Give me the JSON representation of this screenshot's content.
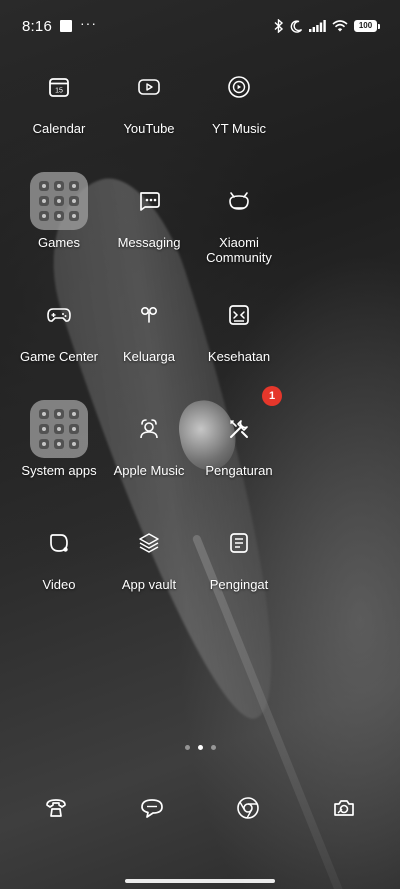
{
  "status_bar": {
    "time": "8:16",
    "more_indicator": "···",
    "battery_level": "100"
  },
  "apps": [
    {
      "label": "Calendar",
      "icon": "calendar-icon",
      "calendar_day": "15"
    },
    {
      "label": "YouTube",
      "icon": "youtube-icon"
    },
    {
      "label": "YT Music",
      "icon": "yt-music-icon"
    },
    {
      "label": "Games",
      "icon": "folder-icon"
    },
    {
      "label": "Messaging",
      "icon": "messaging-icon"
    },
    {
      "label": "Xiaomi Community",
      "icon": "xiaomi-community-icon"
    },
    {
      "label": "Game Center",
      "icon": "gamepad-icon"
    },
    {
      "label": "Keluarga",
      "icon": "family-link-icon"
    },
    {
      "label": "Kesehatan",
      "icon": "health-icon"
    },
    {
      "label": "System apps",
      "icon": "folder-icon"
    },
    {
      "label": "Apple Music",
      "icon": "apple-music-icon"
    },
    {
      "label": "Pengaturan",
      "icon": "settings-icon",
      "badge": "1"
    },
    {
      "label": "Video",
      "icon": "video-icon"
    },
    {
      "label": "App vault",
      "icon": "app-vault-icon"
    },
    {
      "label": "Pengingat",
      "icon": "notes-icon"
    }
  ],
  "page_indicator": {
    "pages": 3,
    "active": 2
  },
  "dock": [
    {
      "icon": "phone-icon"
    },
    {
      "icon": "chat-icon"
    },
    {
      "icon": "chrome-icon"
    },
    {
      "icon": "camera-icon"
    }
  ],
  "colors": {
    "badge": "#e5372b",
    "icon_stroke": "#ffffff",
    "folder_bg": "#a0a0a0"
  }
}
